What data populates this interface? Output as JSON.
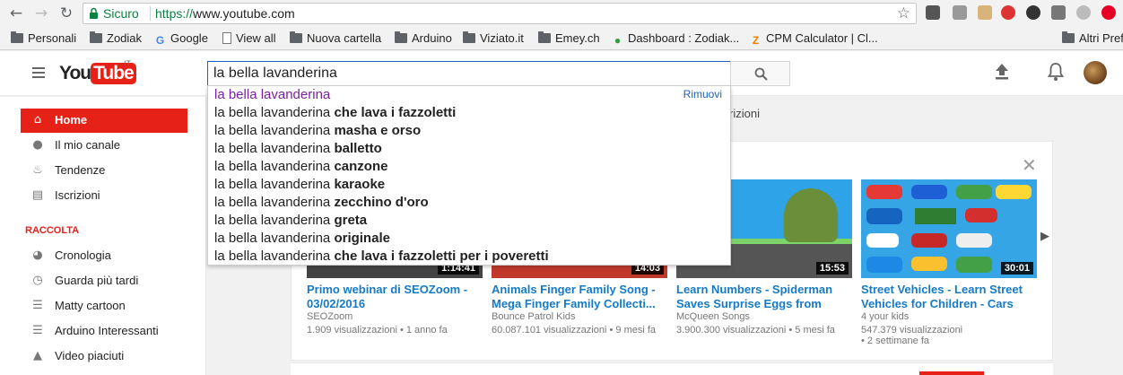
{
  "browser": {
    "secure_label": "Sicuro",
    "url_scheme": "https://",
    "url_host": "www.youtube.com",
    "bookmarks": [
      {
        "label": "Personali",
        "type": "folder"
      },
      {
        "label": "Zodiak",
        "type": "folder"
      },
      {
        "label": "Google",
        "type": "google"
      },
      {
        "label": "View all",
        "type": "page"
      },
      {
        "label": "Nuova cartella",
        "type": "folder"
      },
      {
        "label": "Arduino",
        "type": "folder"
      },
      {
        "label": "Viziato.it",
        "type": "folder"
      },
      {
        "label": "Emey.ch",
        "type": "folder"
      },
      {
        "label": "Dashboard : Zodiak...",
        "type": "site"
      },
      {
        "label": "CPM Calculator | Cl...",
        "type": "site-z"
      },
      {
        "label": "Altri Prefe",
        "type": "folder"
      }
    ]
  },
  "header": {
    "logo_you": "You",
    "logo_tube": "Tube",
    "logo_country": "IT",
    "search_value": "la bella lavanderina"
  },
  "suggestions": {
    "remove_label": "Rimuovi",
    "prefix": "la bella lavanderina",
    "items": [
      {
        "suffix": ""
      },
      {
        "suffix": "che lava i fazzoletti"
      },
      {
        "suffix": "masha e orso"
      },
      {
        "suffix": "balletto"
      },
      {
        "suffix": "canzone"
      },
      {
        "suffix": "karaoke"
      },
      {
        "suffix": "zecchino d'oro"
      },
      {
        "suffix": "greta"
      },
      {
        "suffix": "originale"
      },
      {
        "suffix": "che lava i fazzoletti per i poveretti"
      }
    ]
  },
  "sidebar": {
    "items": [
      {
        "label": "Home",
        "icon": "home-icon"
      },
      {
        "label": "Il mio canale",
        "icon": "user-icon"
      },
      {
        "label": "Tendenze",
        "icon": "flame-icon"
      },
      {
        "label": "Iscrizioni",
        "icon": "subscriptions-icon"
      }
    ],
    "section_title": "RACCOLTA",
    "library": [
      {
        "label": "Cronologia",
        "icon": "history-icon"
      },
      {
        "label": "Guarda più tardi",
        "icon": "clock-icon"
      },
      {
        "label": "Matty cartoon",
        "icon": "playlist-icon"
      },
      {
        "label": "Arduino Interessanti",
        "icon": "playlist-icon"
      },
      {
        "label": "Video piaciuti",
        "icon": "thumbs-up-icon"
      }
    ]
  },
  "main": {
    "tab_fragment": "rizioni",
    "videos": [
      {
        "title": "Primo webinar di SEOZoom - 03/02/2016",
        "channel": "SEOZoom",
        "views": "1.909 visualizzazioni",
        "age": "1 anno fa",
        "duration": "1:14:41"
      },
      {
        "title": "Animals Finger Family Song - Mega Finger Family Collecti...",
        "channel": "Bounce Patrol Kids",
        "views": "60.087.101 visualizzazioni",
        "age": "9 mesi fa",
        "duration": "14:03"
      },
      {
        "title": "Learn Numbers - Spiderman Saves Surprise Eggs from",
        "channel": "McQueen Songs",
        "views": "3.900.300 visualizzazioni",
        "age": "5 mesi fa",
        "duration": "15:53"
      },
      {
        "title": "Street Vehicles - Learn Street Vehicles for Children - Cars",
        "channel": "4 your kids",
        "views": "547.379 visualizzazioni",
        "age": "2 settimane fa",
        "duration": "30:01"
      }
    ]
  },
  "colors": {
    "brand_red": "#e62117",
    "link_blue": "#167ac6",
    "search_focus": "#1c62b9",
    "secure_green": "#0b8043"
  }
}
